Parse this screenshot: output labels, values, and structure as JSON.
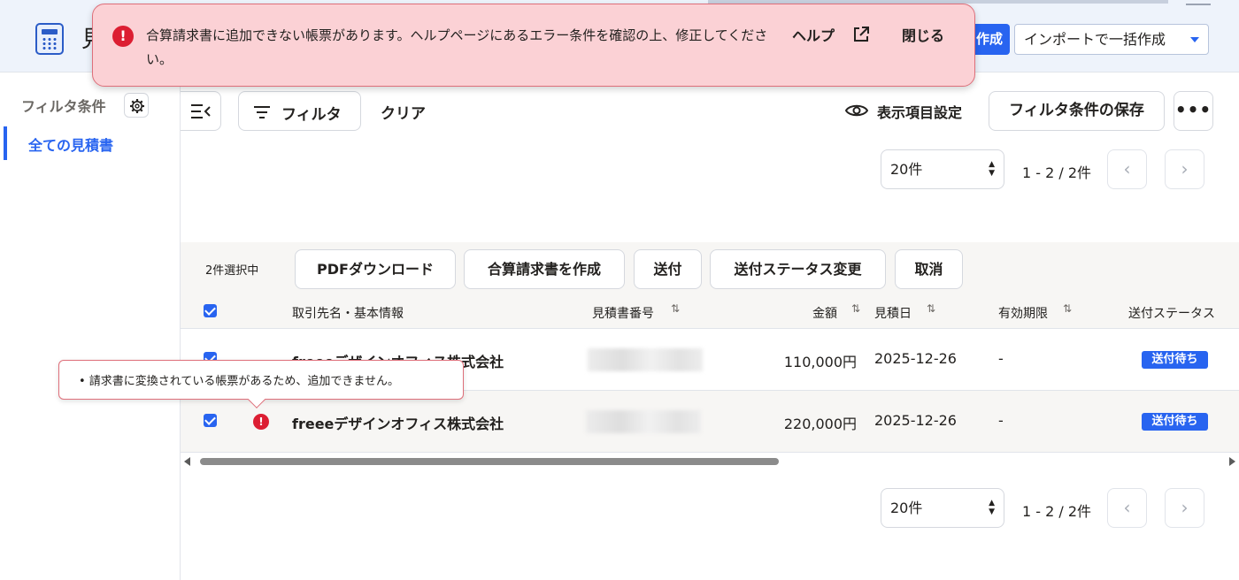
{
  "header": {
    "title_char": "見",
    "create_label": "作成",
    "import_label": "インポートで一括作成"
  },
  "alert": {
    "message": "合算請求書に追加できない帳票があります。ヘルプページにあるエラー条件を確認の上、修正してください。",
    "help_label": "ヘルプ",
    "close_label": "閉じる",
    "color": "#dc1e32"
  },
  "sidebar": {
    "filter_title": "フィルタ条件",
    "active_item": "全ての見積書"
  },
  "toolbar": {
    "filter_label": "フィルタ",
    "clear_label": "クリア",
    "display_settings_label": "表示項目設定",
    "save_filter_label": "フィルタ条件の保存",
    "more_label": "•••"
  },
  "pagination": {
    "per_page": "20件",
    "info": "1 - 2 / 2件",
    "prev": "‹",
    "next": "›"
  },
  "bulk": {
    "selected_count": "2件選択中",
    "pdf_label": "PDFダウンロード",
    "combined_label": "合算請求書を作成",
    "send_label": "送付",
    "status_change_label": "送付ステータス変更",
    "cancel_label": "取消"
  },
  "table": {
    "columns": {
      "client": "取引先名・基本情報",
      "number": "見積書番号",
      "amount": "金額",
      "date": "見積日",
      "expiry": "有効期限",
      "status": "送付ステータス"
    },
    "rows": [
      {
        "client": "freeeデザインオフィス株式会社",
        "amount": "110,000円",
        "date": "2025-12-26",
        "expiry": "-",
        "status": "送付待ち",
        "error": false
      },
      {
        "client": "freeeデザインオフィス株式会社",
        "amount": "220,000円",
        "date": "2025-12-26",
        "expiry": "-",
        "status": "送付待ち",
        "error": true
      }
    ]
  },
  "tooltip": {
    "text": "•  請求書に変換されている帳票があるため、追加できません。"
  },
  "colors": {
    "accent": "#2864f0",
    "error": "#dc1e32",
    "banner_bg": "#fbd1d5"
  }
}
